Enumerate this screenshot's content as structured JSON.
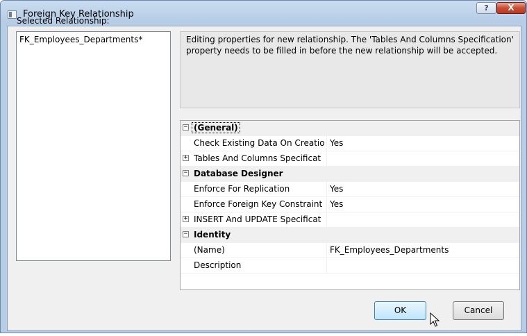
{
  "window": {
    "title": "Foreign Key Relationship",
    "help_glyph": "?",
    "close_glyph": "X"
  },
  "selected_relationship_label": "Selected Relationship:",
  "relationships": [
    "FK_Employees_Departments*"
  ],
  "description": "Editing properties for new relationship.  The 'Tables And Columns Specification' property needs to be filled in before the new relationship will be accepted.",
  "property_grid": {
    "general": {
      "label": "(General)",
      "check_existing_name": "Check Existing Data On Creatio",
      "check_existing_value": "Yes",
      "tables_columns_name": "Tables And Columns Specificat",
      "tables_columns_value": ""
    },
    "database_designer": {
      "label": "Database Designer",
      "enforce_replication_name": "Enforce For Replication",
      "enforce_replication_value": "Yes",
      "enforce_fk_name": "Enforce Foreign Key Constraint",
      "enforce_fk_value": "Yes",
      "insert_update_name": "INSERT And UPDATE Specificat",
      "insert_update_value": ""
    },
    "identity": {
      "label": "Identity",
      "name_name": "(Name)",
      "name_value": "FK_Employees_Departments",
      "description_name": "Description",
      "description_value": ""
    },
    "expanded_glyph": "−",
    "collapsed_glyph": "+"
  },
  "buttons": {
    "ok": "OK",
    "cancel": "Cancel"
  }
}
